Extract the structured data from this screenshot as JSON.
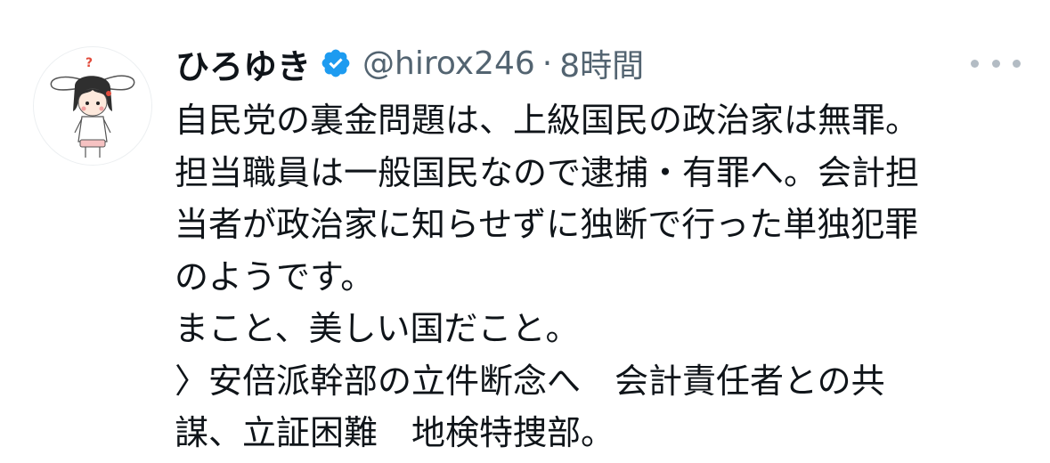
{
  "tweet": {
    "author": {
      "display_name": "ひろゆき",
      "handle": "@hirox246",
      "verified": true,
      "avatar_icon": "cartoon-bunny-avatar"
    },
    "separator": "·",
    "time_ago": "8時間",
    "more_icon": "more-horizontal-icon",
    "body_lines": [
      "自民党の裏金問題は、上級国民の政治家は無罪。",
      "担当職員は一般国民なので逮捕・有罪へ。会計担",
      "当者が政治家に知らせずに独断で行った単独犯罪",
      "のようです。",
      "まこと、美しい国だこと。",
      "〉安倍派幹部の立件断念へ　会計責任者との共",
      "謀、立証困難　地検特捜部。"
    ]
  },
  "colors": {
    "text_primary": "#0f1419",
    "text_secondary": "#536471",
    "verified_blue": "#1d9bf0"
  }
}
